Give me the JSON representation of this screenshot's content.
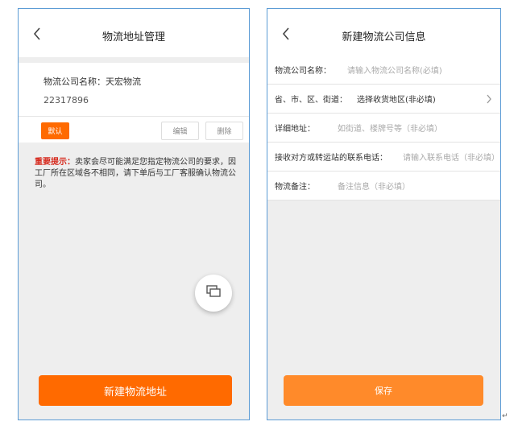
{
  "left_screen": {
    "title": "物流地址管理",
    "company_line": "物流公司名称：天宏物流",
    "phone": "22317896",
    "default_label": "默认",
    "edit_label": "编辑",
    "delete_label": "删除",
    "notice_label": "重要提示：",
    "notice_text": "卖家会尽可能满足您指定物流公司的要求，因工厂所在区域各不相同，请下单后与工厂客服确认物流公司。",
    "new_address_button": "新建物流地址"
  },
  "right_screen": {
    "title": "新建物流公司信息",
    "fields": {
      "name_label": "物流公司名称：",
      "name_placeholder": "请输入物流公司名称(必填)",
      "region_label": "省、市、区、街道：",
      "region_value": "选择收货地区(非必填)",
      "address_label": "详细地址：",
      "address_placeholder": "如街道、楼牌号等（非必填）",
      "contact_label": "接收对方或转运站的联系电话：",
      "contact_placeholder": "请输入联系电话（非必填）",
      "note_label": "物流备注：",
      "note_placeholder": "备注信息（非必填）"
    },
    "save_button": "保存"
  },
  "corner_mark": "↵",
  "colors": {
    "accent": "#ff6a00",
    "save_button": "#ff8a2a",
    "notice_label": "#d62b1f",
    "frame_border": "#5b9bd5",
    "page_background": "#eeeeee"
  },
  "icons": {
    "back": "chevron-left-icon",
    "float": "window-switch-icon",
    "region_arrow": "chevron-right-icon"
  }
}
